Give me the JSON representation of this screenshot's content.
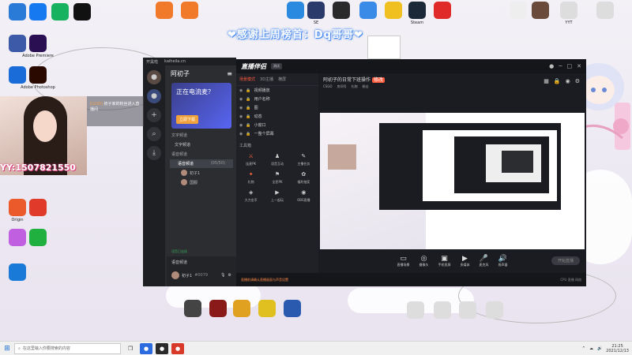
{
  "banner": "❤感谢上周榜首：Dq哥哥❤",
  "desktop_icons_left": [
    {
      "label": "",
      "color": "#2a7ad8"
    },
    {
      "label": "",
      "color": "#1679f0"
    },
    {
      "label": "",
      "color": "#16b25f"
    },
    {
      "label": "",
      "color": "#111111"
    },
    {
      "label": "",
      "color": "#3d5aa8"
    },
    {
      "label": "Adobe Premiere",
      "color": "#2a1052"
    },
    {
      "label": "",
      "color": "#1a6dd8"
    },
    {
      "label": "Adobe Photoshop",
      "color": "#2a0a00"
    },
    {
      "label": "",
      "color": "#1a6dd8"
    },
    {
      "label": "",
      "color": "#f09010"
    },
    {
      "label": "Origin",
      "color": "#ea5a2a"
    },
    {
      "label": "",
      "color": "#e03a2a"
    },
    {
      "label": "",
      "color": "#c060e0"
    },
    {
      "label": "",
      "color": "#20b040"
    },
    {
      "label": "",
      "color": "#1a7ad8"
    }
  ],
  "desktop_icons_top": [
    {
      "label": "",
      "color": "#f07a2a"
    },
    {
      "label": "",
      "color": "#f07a2a"
    },
    {
      "label": "",
      "color": "#2a8ae0"
    },
    {
      "label": "SE",
      "color": "#2a3a6a"
    },
    {
      "label": "",
      "color": "#2a2a2a"
    },
    {
      "label": "",
      "color": "#3a8ae8"
    },
    {
      "label": "",
      "color": "#f0c020"
    },
    {
      "label": "Steam",
      "color": "#1b2838"
    },
    {
      "label": "",
      "color": "#e02a2a"
    },
    {
      "label": "",
      "color": "#eeeeee"
    },
    {
      "label": "",
      "color": "#6a4a3a"
    },
    {
      "label": "YYT",
      "color": "#dddddd"
    },
    {
      "label": "",
      "color": "#dddddd"
    }
  ],
  "desktop_icons_bottom": [
    {
      "label": "",
      "color": "#444444"
    },
    {
      "label": "",
      "color": "#8a1a1a"
    },
    {
      "label": "",
      "color": "#e0a020"
    },
    {
      "label": "",
      "color": "#e0c020"
    },
    {
      "label": "",
      "color": "#2a5ab0"
    },
    {
      "label": "",
      "color": "#dddddd"
    },
    {
      "label": "",
      "color": "#dddddd"
    },
    {
      "label": "",
      "color": "#dddddd"
    },
    {
      "label": "",
      "color": "#dddddd"
    }
  ],
  "chat": {
    "bar": [
      "开黑啦",
      "kaiheila.cn"
    ],
    "server": "阿初子",
    "promo_title": "正在电流麦？",
    "promo_btn": "立即下载",
    "sections": [
      "文字频道",
      "文字频道",
      "语音频道"
    ],
    "voice_channel": "语音频道",
    "voice_count": "(05/50)",
    "members": [
      "初子1",
      "国服"
    ],
    "voice_status": "语音已连接",
    "user": "初子1",
    "user_id": "#0079",
    "footer_label": "语音频道"
  },
  "stream": {
    "logo": "直播伴侣",
    "badge": "测试",
    "tabs": [
      "场景模式",
      "3D主播",
      "横屏"
    ],
    "sources": [
      "视频播放",
      "用户名称",
      "图",
      "动态",
      "小窗口",
      "一整个屏幕"
    ],
    "title": "阿初子的日常下班操作",
    "tag": "修改",
    "meta": [
      "CSGO",
      "房间号",
      "礼物",
      "粉丝"
    ],
    "tools_label": "工具箱",
    "tools": [
      "连麦PK",
      "语音互动",
      "主播任务",
      "礼物",
      "全民PK",
      "福利抽奖",
      "大力金币",
      "上一起玩",
      "OBS直播"
    ],
    "bottom": [
      "直播场景",
      "摄像头",
      "手机投屏",
      "多媒体",
      "麦克风",
      "扬声器"
    ],
    "go_live": "开始直播",
    "status": "直播前请确认直播画面与声音设置",
    "status_right": "CPU 直播 网络"
  },
  "overlay": {
    "qq": "YY:1507821550",
    "msg_level": "[LV20]",
    "msg_text": "初子家的粉丝进入直播间"
  },
  "taskbar": {
    "search_placeholder": "在这里输入你要搜索的内容",
    "time": "21:25",
    "date": "2021/12/13"
  }
}
